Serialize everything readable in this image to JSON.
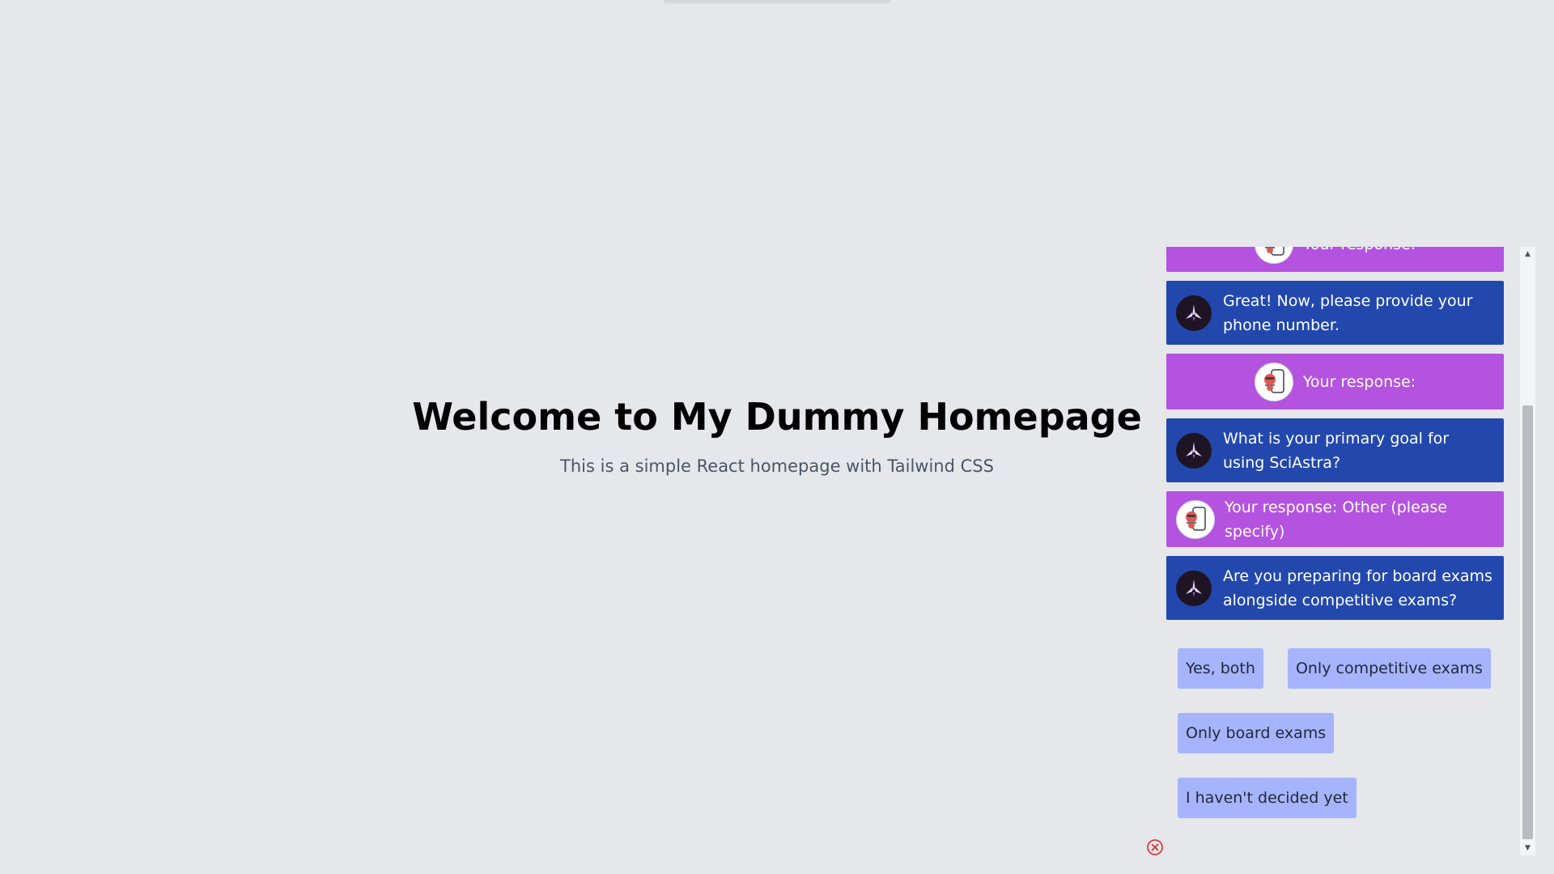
{
  "hero": {
    "title": "Welcome to My Dummy Homepage",
    "subtitle": "This is a simple React homepage with Tailwind CSS"
  },
  "chat": {
    "messages": [
      {
        "role": "user",
        "text": "Your response:"
      },
      {
        "role": "bot",
        "text": "Great! Now, please provide your phone number."
      },
      {
        "role": "user",
        "text": "Your response:"
      },
      {
        "role": "bot",
        "text": "What is your primary goal for using SciAstra?"
      },
      {
        "role": "user",
        "text": "Your response: Other (please specify)"
      },
      {
        "role": "bot",
        "text": "Are you preparing for board exams alongside competitive exams?"
      }
    ],
    "options": [
      "Yes, both",
      "Only competitive exams",
      "Only board exams",
      "I haven't decided yet"
    ]
  },
  "colors": {
    "background": "#e5e7eb",
    "user_bubble": "#b453e0",
    "bot_bubble": "#2348ad",
    "option_button": "#a5b4fc",
    "close_icon": "#dc2626"
  },
  "icons": {
    "user_avatar": "robot-phone-avatar-icon",
    "bot_avatar": "rocket-logo-icon",
    "close": "close-circle-icon",
    "scroll_up": "scroll-up-arrow-icon",
    "scroll_down": "scroll-down-arrow-icon"
  }
}
